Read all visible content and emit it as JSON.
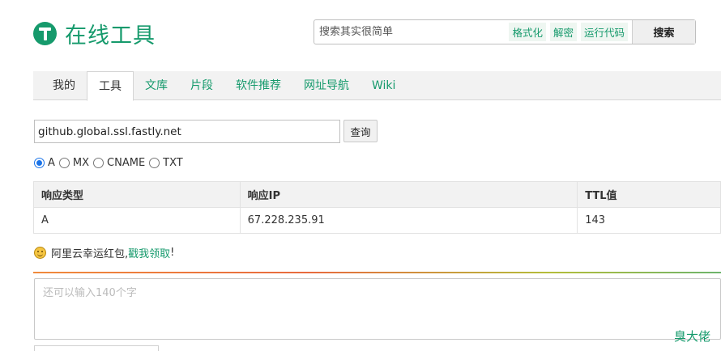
{
  "header": {
    "site_title": "在线工具",
    "logo_icon": "tool-t-logo",
    "search": {
      "placeholder": "搜索其实很简单",
      "chips": [
        "格式化",
        "解密",
        "运行代码"
      ],
      "button_label": "搜索"
    }
  },
  "tabs": [
    {
      "label": "我的",
      "state": "plain"
    },
    {
      "label": "工具",
      "state": "active"
    },
    {
      "label": "文库",
      "state": "link"
    },
    {
      "label": "片段",
      "state": "link"
    },
    {
      "label": "软件推荐",
      "state": "link"
    },
    {
      "label": "网址导航",
      "state": "link"
    },
    {
      "label": "Wiki",
      "state": "link"
    }
  ],
  "query": {
    "domain_value": "github.global.ssl.fastly.net",
    "button_label": "查询",
    "record_types": [
      {
        "label": "A",
        "checked": true
      },
      {
        "label": "MX",
        "checked": false
      },
      {
        "label": "CNAME",
        "checked": false
      },
      {
        "label": "TXT",
        "checked": false
      }
    ]
  },
  "results": {
    "headers": [
      "响应类型",
      "响应IP",
      "TTL值"
    ],
    "rows": [
      [
        "A",
        "67.228.235.91",
        "143"
      ]
    ]
  },
  "promo": {
    "text": "阿里云幸运红包,",
    "link": "戳我领取",
    "suffix": "!"
  },
  "comment": {
    "placeholder": "还可以输入140个字"
  },
  "footer_signature": "臭大佬",
  "colors": {
    "brand_green": "#169a6c",
    "radio_blue": "#1a73e8"
  }
}
